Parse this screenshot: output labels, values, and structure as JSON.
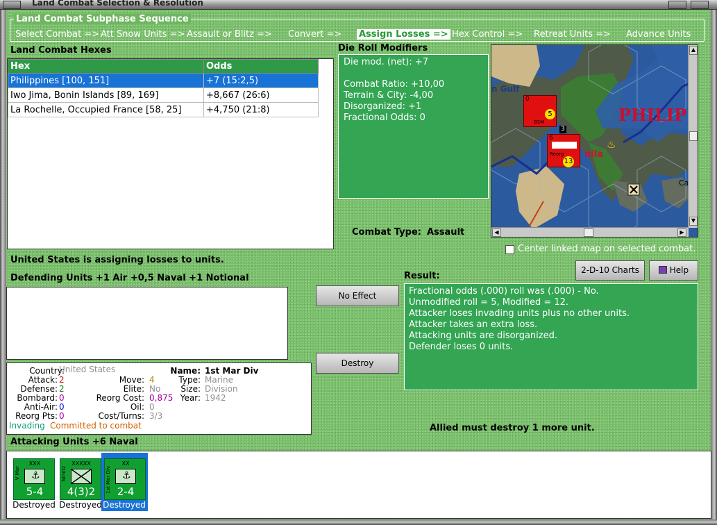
{
  "window": {
    "title": "Land Combat Selection & Resolution"
  },
  "sequence": {
    "title": "Land Combat Subphase Sequence",
    "steps": [
      "Select Combat =>",
      "Att Snow Units =>",
      "Assault or Blitz =>",
      "Convert =>",
      "Assign Losses =>",
      "Hex Control =>",
      "Retreat Units =>",
      "Advance Units"
    ],
    "active": "Assign Losses =>"
  },
  "hexes": {
    "label": "Land Combat Hexes",
    "columns": [
      "Hex",
      "Odds"
    ],
    "rows": [
      {
        "hex": "Philippines [100, 151]",
        "odds": "+7 (15:2,5)",
        "selected": true
      },
      {
        "hex": "Iwo Jima, Bonin Islands [89, 169]",
        "odds": "+8,667 (26:6)"
      },
      {
        "hex": "La Rochelle, Occupied France [58, 25]",
        "odds": "+4,750 (21:8)"
      }
    ]
  },
  "modifiers": {
    "label": "Die Roll Modifiers",
    "net": "Die mod. (net): +7",
    "lines": [
      "Combat Ratio: +10,00",
      "Terrain & City: -4,00",
      "Disorganized: +1",
      "Fractional Odds: 0"
    ]
  },
  "combat_type": {
    "label": "Combat Type:",
    "value": "Assault"
  },
  "map": {
    "labels": [
      "n Gulf",
      "PHILIP",
      "nila",
      "Ca"
    ],
    "center_checkbox": "Center linked map on selected combat.",
    "counter1": {
      "top": "0",
      "str": "5",
      "name": "BSM"
    },
    "counter2": {
      "top": "6",
      "name": "Reorg",
      "str": "13",
      "tag": "3"
    }
  },
  "status_text": "United States is assigning losses to units.",
  "buttons": {
    "charts": "2-D-10 Charts",
    "help": "Help",
    "no_effect": "No Effect",
    "destroy": "Destroy"
  },
  "defending": {
    "label": "Defending Units +1 Air +0,5 Naval +1 Notional"
  },
  "result": {
    "label": "Result:",
    "lines": [
      "Fractional odds (.000) roll was (.000)  - No.",
      "Unmodified roll = 5, Modified = 12.",
      "Attacker loses invading units plus no other units.",
      "Attacker takes an extra loss.",
      "Attacking units are disorganized.",
      "Defender loses 0 units."
    ]
  },
  "unit_info": {
    "country_k": "Country:",
    "country": "United States",
    "attack_k": "Attack:",
    "attack": "2",
    "defense_k": "Defense:",
    "defense": "2",
    "bombard_k": "Bombard:",
    "bombard": "0",
    "antiair_k": "Anti-Air:",
    "antiair": "0",
    "reorg_k": "Reorg Pts:",
    "reorg": "0",
    "move_k": "Move:",
    "move": "4",
    "elite_k": "Elite:",
    "elite": "No",
    "reorgcost_k": "Reorg Cost:",
    "reorgcost": "0,875",
    "oil_k": "Oil:",
    "oil": "0",
    "cost_k": "Cost/Turns:",
    "cost": "3/3",
    "name_k": "Name:",
    "name": "1st Mar Div",
    "type_k": "Type:",
    "type": "Marine",
    "size_k": "Size:",
    "size": "Division",
    "year_k": "Year:",
    "year": "1942",
    "invading": "Invading",
    "committed": "Committed to combat",
    "colors": {
      "red": "#d01010",
      "green": "#108010",
      "blue": "#1010d0",
      "purple": "#a000a0",
      "gray": "#909090",
      "gold": "#b08000",
      "teal": "#10a080",
      "orange": "#d06000"
    }
  },
  "must_destroy": "Allied must destroy 1 more unit.",
  "attacking": {
    "label": "Attacking Units +6 Naval",
    "units": [
      {
        "echelon": "XXX",
        "name": "V Mar",
        "strength": "5-4",
        "status": "Destroyed",
        "icon": "anchor-marine-icon"
      },
      {
        "echelon": "XXXXX",
        "name": "Nimitz",
        "strength": "4(3)2",
        "status": "Destroyed",
        "icon": "hq-cross-icon"
      },
      {
        "echelon": "XX",
        "name": "1st Mar Div",
        "strength": "2-4",
        "status": "Destroyed",
        "icon": "anchor-marine-icon",
        "selected": true
      }
    ]
  }
}
